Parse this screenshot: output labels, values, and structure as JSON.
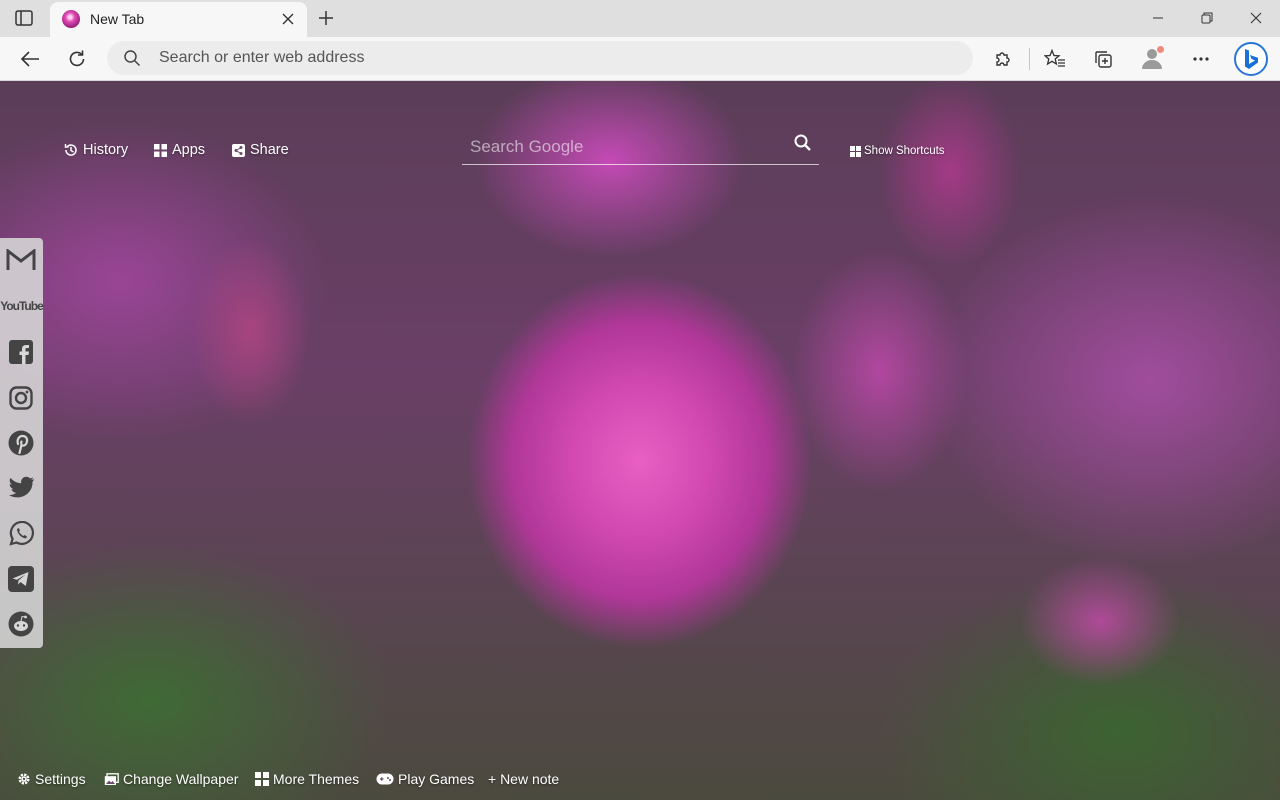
{
  "tab": {
    "title": "New Tab"
  },
  "addressbar": {
    "placeholder": "Search or enter web address"
  },
  "ntp": {
    "links": {
      "history": "History",
      "apps": "Apps",
      "share": "Share"
    },
    "search_placeholder": "Search Google",
    "shortcuts_label": "Show Shortcuts",
    "social": [
      "gmail-icon",
      "youtube-icon",
      "facebook-icon",
      "instagram-icon",
      "pinterest-icon",
      "twitter-icon",
      "whatsapp-icon",
      "telegram-icon",
      "reddit-icon"
    ],
    "youtube_label": "YouTube",
    "bottom": {
      "settings": "Settings",
      "change_wallpaper": "Change Wallpaper",
      "more_themes": "More Themes",
      "play_games": "Play Games",
      "new_note": "+ New note"
    }
  },
  "colors": {
    "accent": "#2a76d6",
    "tabbar": "#dfdfdf",
    "toolbar": "#f7f7f7"
  }
}
